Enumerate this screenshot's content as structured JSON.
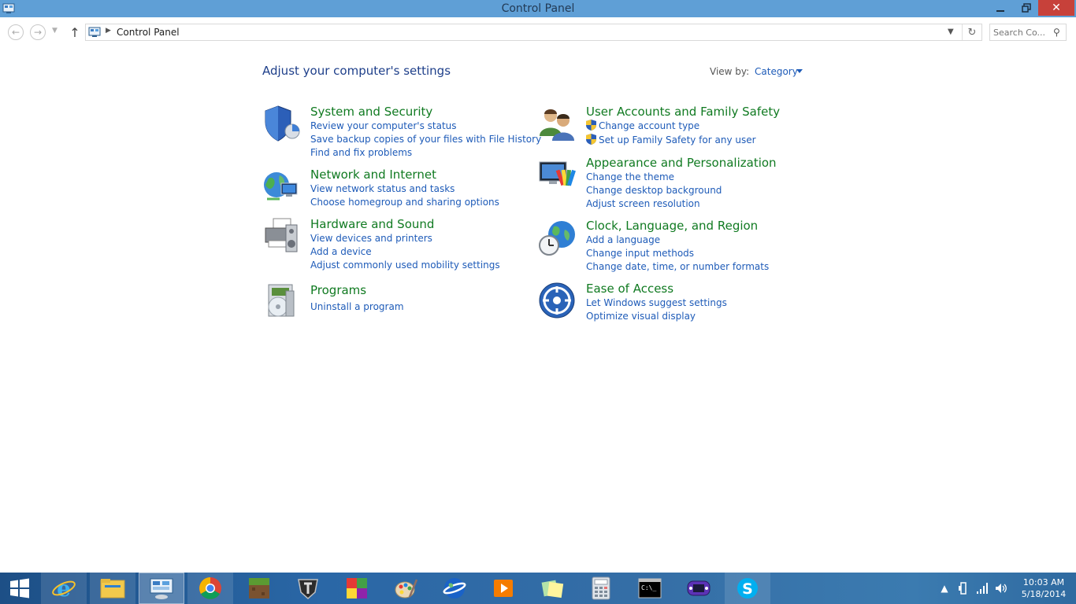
{
  "window": {
    "title": "Control Panel",
    "controls": {
      "minimize": "—",
      "maximize": "❐",
      "close": "✕"
    }
  },
  "navigation": {
    "back_icon": "back-arrow-icon",
    "forward_icon": "forward-arrow-icon",
    "up_icon": "up-arrow-icon",
    "breadcrumb": [
      "Control Panel"
    ],
    "search_placeholder": "Search Co..."
  },
  "content": {
    "heading": "Adjust your computer's settings",
    "view_by_label": "View by:",
    "view_by_value": "Category",
    "categories": [
      {
        "title": "System and Security",
        "icon": "shield-icon",
        "links": [
          "Review your computer's status",
          "Save backup copies of your files with File History",
          "Find and fix problems"
        ]
      },
      {
        "title": "Network and Internet",
        "icon": "network-globe-icon",
        "links": [
          "View network status and tasks",
          "Choose homegroup and sharing options"
        ]
      },
      {
        "title": "Hardware and Sound",
        "icon": "printer-speaker-icon",
        "links": [
          "View devices and printers",
          "Add a device",
          "Adjust commonly used mobility settings"
        ]
      },
      {
        "title": "Programs",
        "icon": "programs-disc-icon",
        "links": [
          "Uninstall a program"
        ]
      },
      {
        "title": "User Accounts and Family Safety",
        "icon": "users-icon",
        "links": [
          "Change account type",
          "Set up Family Safety for any user"
        ]
      },
      {
        "title": "Appearance and Personalization",
        "icon": "monitor-palette-icon",
        "links": [
          "Change the theme",
          "Change desktop background",
          "Adjust screen resolution"
        ]
      },
      {
        "title": "Clock, Language, and Region",
        "icon": "globe-clock-icon",
        "links": [
          "Add a language",
          "Change input methods",
          "Change date, time, or number formats"
        ]
      },
      {
        "title": "Ease of Access",
        "icon": "ease-of-access-icon",
        "links": [
          "Let Windows suggest settings",
          "Optimize visual display"
        ]
      }
    ]
  },
  "taskbar": {
    "apps": [
      "start-icon",
      "internet-explorer-icon",
      "file-explorer-icon",
      "control-panel-icon",
      "chrome-icon",
      "minecraft-icon",
      "world-of-tanks-icon",
      "color-blocks-icon",
      "paint-icon",
      "google-earth-icon",
      "media-player-icon",
      "sticky-notes-icon",
      "calculator-icon",
      "command-prompt-icon",
      "gamepad-icon",
      "skype-icon"
    ],
    "clock_time": "10:03 AM",
    "clock_date": "5/18/2014"
  },
  "colors": {
    "titlebar": "#5f9fd6",
    "category_title": "#107a21",
    "link": "#1e5bb8",
    "heading": "#1e3f8a",
    "close_button": "#c7413a"
  }
}
